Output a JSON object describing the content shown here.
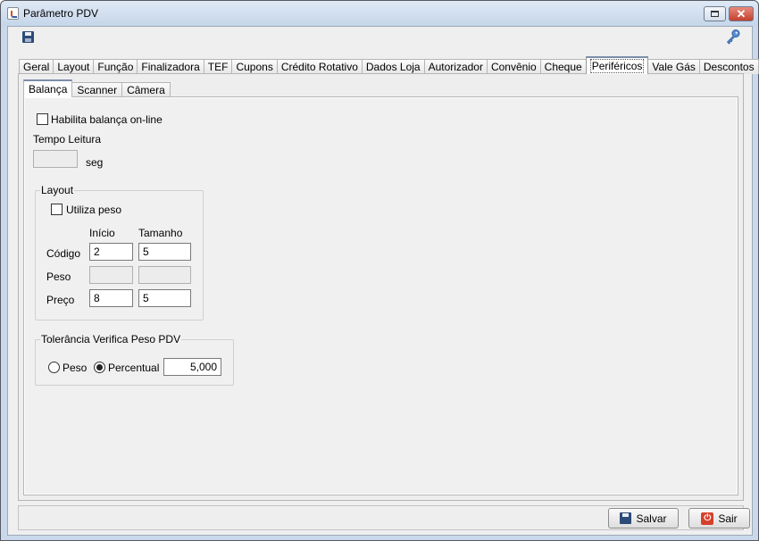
{
  "window": {
    "title": "Parâmetro PDV"
  },
  "tabs": [
    {
      "label": "Geral"
    },
    {
      "label": "Layout"
    },
    {
      "label": "Função"
    },
    {
      "label": "Finalizadora"
    },
    {
      "label": "TEF"
    },
    {
      "label": "Cupons"
    },
    {
      "label": "Crédito Rotativo"
    },
    {
      "label": "Dados Loja"
    },
    {
      "label": "Autorizador"
    },
    {
      "label": "Convênio"
    },
    {
      "label": "Cheque"
    },
    {
      "label": "Periféricos"
    },
    {
      "label": "Vale Gás"
    },
    {
      "label": "Descontos"
    }
  ],
  "active_tab": "Periféricos",
  "subtabs": [
    {
      "label": "Balança"
    },
    {
      "label": "Scanner"
    },
    {
      "label": "Câmera"
    }
  ],
  "active_subtab": "Balança",
  "balanca": {
    "habilita_label": "Habilita balança on-line",
    "habilita_checked": false,
    "tempo_leitura_label": "Tempo Leitura",
    "tempo_leitura_value": "",
    "tempo_unit": "seg",
    "layout": {
      "title": "Layout",
      "utiliza_peso_label": "Utiliza peso",
      "utiliza_peso_checked": false,
      "col_inicio": "Início",
      "col_tamanho": "Tamanho",
      "rows": [
        {
          "label": "Código",
          "inicio": "2",
          "tamanho": "5",
          "enabled": true
        },
        {
          "label": "Peso",
          "inicio": "",
          "tamanho": "",
          "enabled": false
        },
        {
          "label": "Preço",
          "inicio": "8",
          "tamanho": "5",
          "enabled": true
        }
      ]
    },
    "tolerancia": {
      "title": "Tolerância Verifica Peso PDV",
      "option_peso": "Peso",
      "option_percentual": "Percentual",
      "selected": "Percentual",
      "value": "5,000"
    }
  },
  "buttons": {
    "save_label": "Salvar",
    "exit_label": "Sair"
  }
}
